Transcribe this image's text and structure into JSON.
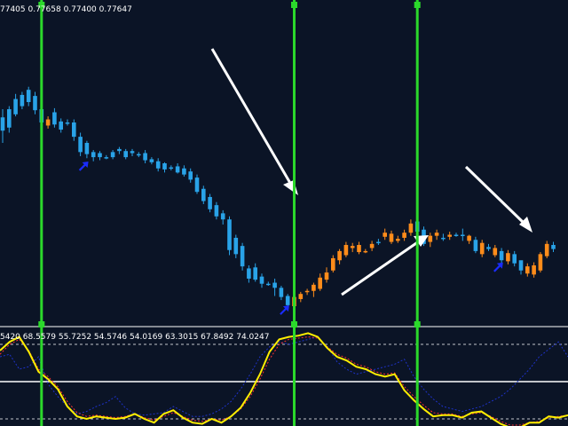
{
  "price_header": "77405 0.77658 0.77400 0.77647",
  "indicator_header": "5420 68.5579 55.7252 54.5746 54.0169 63.3015 67.8492 74.0247",
  "chart_data": [
    {
      "type": "candlestick",
      "title": "",
      "colors": {
        "up": "#29a3e8",
        "down": "#ff8c1a",
        "vline": "#2bd92b",
        "arrow_white": "#ffffff",
        "arrow_blue": "#1a2cff",
        "background": "#0b1426"
      },
      "ylim": [
        0,
        100
      ],
      "candles": [
        [
          72,
          85,
          60,
          93
        ],
        [
          75,
          93,
          70,
          96
        ],
        [
          88,
          103,
          86,
          108
        ],
        [
          96,
          107,
          93,
          110
        ],
        [
          100,
          112,
          96,
          115
        ],
        [
          92,
          106,
          88,
          110
        ],
        [
          80,
          93,
          76,
          95
        ],
        [
          83,
          77,
          74,
          86
        ],
        [
          78,
          90,
          75,
          94
        ],
        [
          73,
          81,
          70,
          84
        ],
        [
          80,
          80,
          77,
          83
        ],
        [
          66,
          80,
          62,
          83
        ],
        [
          51,
          66,
          47,
          70
        ],
        [
          49,
          60,
          45,
          62
        ],
        [
          46,
          51,
          42,
          53
        ],
        [
          46,
          50,
          43,
          52
        ],
        [
          46,
          46,
          44,
          48
        ],
        [
          46,
          51,
          44,
          53
        ],
        [
          52,
          54,
          49,
          56
        ],
        [
          46,
          52,
          44,
          54
        ],
        [
          50,
          52,
          47,
          54
        ],
        [
          49,
          49,
          46,
          51
        ],
        [
          43,
          50,
          40,
          53
        ],
        [
          41,
          44,
          39,
          46
        ],
        [
          35,
          42,
          32,
          45
        ],
        [
          34,
          40,
          31,
          41
        ],
        [
          36,
          36,
          33,
          38
        ],
        [
          31,
          37,
          30,
          40
        ],
        [
          29,
          35,
          27,
          38
        ],
        [
          24,
          32,
          21,
          35
        ],
        [
          12,
          26,
          10,
          29
        ],
        [
          3,
          15,
          0,
          18
        ],
        [
          -5,
          7,
          -8,
          10
        ],
        [
          -12,
          -1,
          -15,
          2
        ],
        [
          -15,
          -9,
          -20,
          -6
        ],
        [
          -45,
          -15,
          -50,
          -12
        ],
        [
          -49,
          -33,
          -53,
          -30
        ],
        [
          -61,
          -41,
          -65,
          -38
        ],
        [
          -73,
          -63,
          -77,
          -60
        ],
        [
          -74,
          -62,
          -76,
          -58
        ],
        [
          -78,
          -71,
          -82,
          -68
        ],
        [
          -78,
          -78,
          -80,
          -76
        ],
        [
          -82,
          -77,
          -90,
          -73
        ],
        [
          -91,
          -82,
          -94,
          -80
        ],
        [
          -99,
          -90,
          -103,
          -88
        ],
        [
          -91,
          -100,
          -107,
          -89
        ],
        [
          -88,
          -93,
          -96,
          -86
        ],
        [
          -85,
          -86,
          -89,
          -83
        ],
        [
          -79,
          -85,
          -91,
          -77
        ],
        [
          -72,
          -83,
          -85,
          -68
        ],
        [
          -67,
          -74,
          -77,
          -62
        ],
        [
          -53,
          -65,
          -67,
          -50
        ],
        [
          -46,
          -55,
          -59,
          -44
        ],
        [
          -40,
          -50,
          -52,
          -37
        ],
        [
          -41,
          -43,
          -47,
          -38
        ],
        [
          -40,
          -47,
          -49,
          -37
        ],
        [
          -46,
          -47,
          -48,
          -44
        ],
        [
          -39,
          -43,
          -46,
          -36
        ],
        [
          -37,
          -37,
          -40,
          -34
        ],
        [
          -28,
          -32,
          -35,
          -24
        ],
        [
          -29,
          -37,
          -39,
          -26
        ],
        [
          -34,
          -36,
          -38,
          -31
        ],
        [
          -28,
          -33,
          -36,
          -25
        ],
        [
          -19,
          -28,
          -31,
          -15
        ],
        [
          -27,
          -17,
          -30,
          -15
        ],
        [
          -39,
          -25,
          -41,
          -22
        ],
        [
          -31,
          -37,
          -42,
          -28
        ],
        [
          -28,
          -31,
          -35,
          -25
        ],
        [
          -33,
          -33,
          -36,
          -29
        ],
        [
          -30,
          -32,
          -35,
          -27
        ],
        [
          -30,
          -30,
          -32,
          -28
        ],
        [
          -30,
          -30,
          -36,
          -24
        ],
        [
          -31,
          -36,
          -39,
          -30
        ],
        [
          -46,
          -35,
          -48,
          -32
        ],
        [
          -38,
          -49,
          -52,
          -35
        ],
        [
          -44,
          -42,
          -46,
          -39
        ],
        [
          -43,
          -50,
          -52,
          -40
        ],
        [
          -55,
          -46,
          -58,
          -43
        ],
        [
          -48,
          -56,
          -59,
          -45
        ],
        [
          -58,
          -49,
          -61,
          -46
        ],
        [
          -65,
          -55,
          -69,
          -62
        ],
        [
          -61,
          -68,
          -71,
          -58
        ],
        [
          -60,
          -69,
          -72,
          -57
        ],
        [
          -49,
          -65,
          -67,
          -47
        ],
        [
          -39,
          -51,
          -53,
          -36
        ],
        [
          -44,
          -40,
          -47,
          -37
        ]
      ],
      "vlines_at": [
        6,
        45,
        64
      ],
      "blue_arrows_at": [
        12,
        43,
        76
      ]
    },
    {
      "type": "line",
      "title": "",
      "ylim": [
        0,
        100
      ],
      "levels": [
        80,
        50,
        20
      ],
      "series": [
        {
          "color": "#ffee00",
          "values": [
            75,
            82,
            86,
            74,
            58,
            52,
            44,
            30,
            22,
            20,
            22,
            21,
            20,
            21,
            24,
            20,
            17,
            24,
            27,
            21,
            17,
            16,
            20,
            17,
            22,
            29,
            41,
            56,
            74,
            84,
            86,
            87,
            89,
            86,
            77,
            70,
            67,
            62,
            60,
            56,
            54,
            56,
            43,
            35,
            28,
            22,
            23,
            23,
            21,
            25,
            26,
            21,
            16,
            13,
            13,
            17,
            17,
            22,
            21,
            23
          ]
        },
        {
          "color": "#ff3030",
          "values": [
            72,
            80,
            84,
            75,
            60,
            54,
            46,
            34,
            25,
            22,
            23,
            22,
            21,
            22,
            24,
            21,
            19,
            22,
            25,
            22,
            19,
            18,
            20,
            19,
            22,
            28,
            38,
            52,
            68,
            80,
            84,
            85,
            86,
            85,
            78,
            72,
            69,
            64,
            62,
            58,
            56,
            57,
            46,
            38,
            31,
            25,
            24,
            24,
            22,
            24,
            25,
            22,
            18,
            15,
            15,
            17,
            18,
            21,
            22,
            23
          ]
        },
        {
          "color": "#1e32c8",
          "values": [
            70,
            72,
            60,
            62,
            70,
            48,
            38,
            30,
            24,
            26,
            30,
            33,
            38,
            29,
            24,
            23,
            24,
            25,
            30,
            26,
            22,
            22,
            24,
            28,
            34,
            44,
            56,
            70,
            78,
            82,
            80,
            82,
            84,
            86,
            78,
            66,
            60,
            56,
            58,
            60,
            62,
            64,
            68,
            54,
            44,
            36,
            30,
            28,
            26,
            28,
            30,
            34,
            38,
            44,
            52,
            60,
            70,
            76,
            82,
            70
          ]
        }
      ]
    }
  ]
}
